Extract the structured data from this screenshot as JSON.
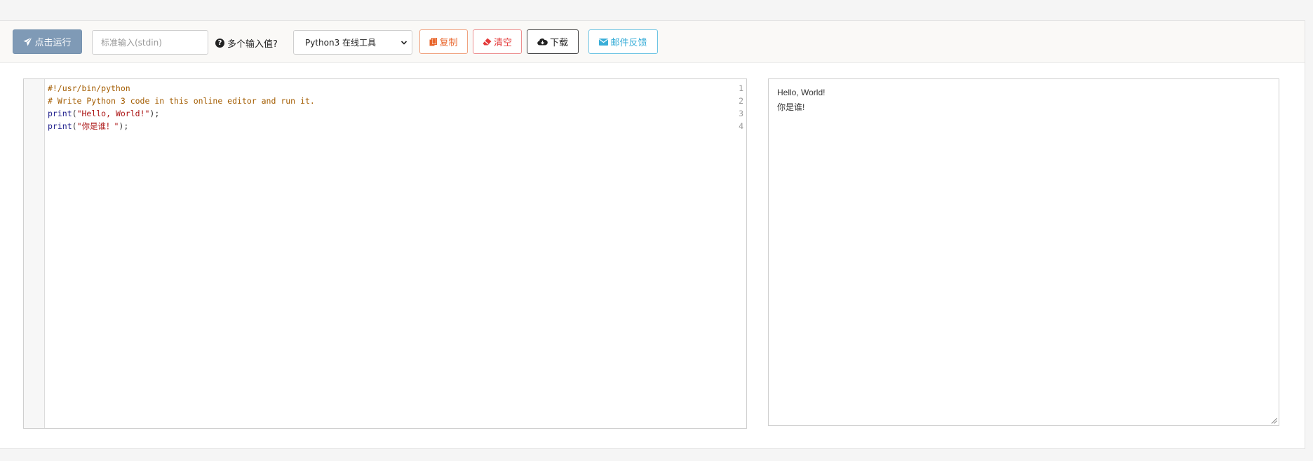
{
  "toolbar": {
    "run_label": "点击运行",
    "stdin_placeholder": "标准输入(stdin)",
    "multi_input_label": "多个输入值?",
    "language_select": "Python3 在线工具",
    "copy_label": "复制",
    "clear_label": "清空",
    "download_label": "下载",
    "mail_label": "邮件反馈"
  },
  "editor": {
    "lines": [
      {
        "num": "1",
        "text": "#!/usr/bin/python"
      },
      {
        "num": "2",
        "text": "# Write Python 3 code in this online editor and run it."
      },
      {
        "num": "3",
        "kw": "print",
        "open": "(",
        "str": "\"Hello, World!\"",
        "close": ");"
      },
      {
        "num": "4",
        "kw": "print",
        "open": "(",
        "str": "\"你是谁！\"",
        "close": ");"
      }
    ]
  },
  "output": {
    "lines": [
      "Hello, World!",
      "你是谁!"
    ]
  },
  "colors": {
    "run_button": "#7f9ab6",
    "copy": "#e8652b",
    "clear": "#e43a3a",
    "mail": "#3aaed8",
    "comment": "#a35c00",
    "keyword": "#1a1a8a",
    "string": "#aa1111"
  }
}
